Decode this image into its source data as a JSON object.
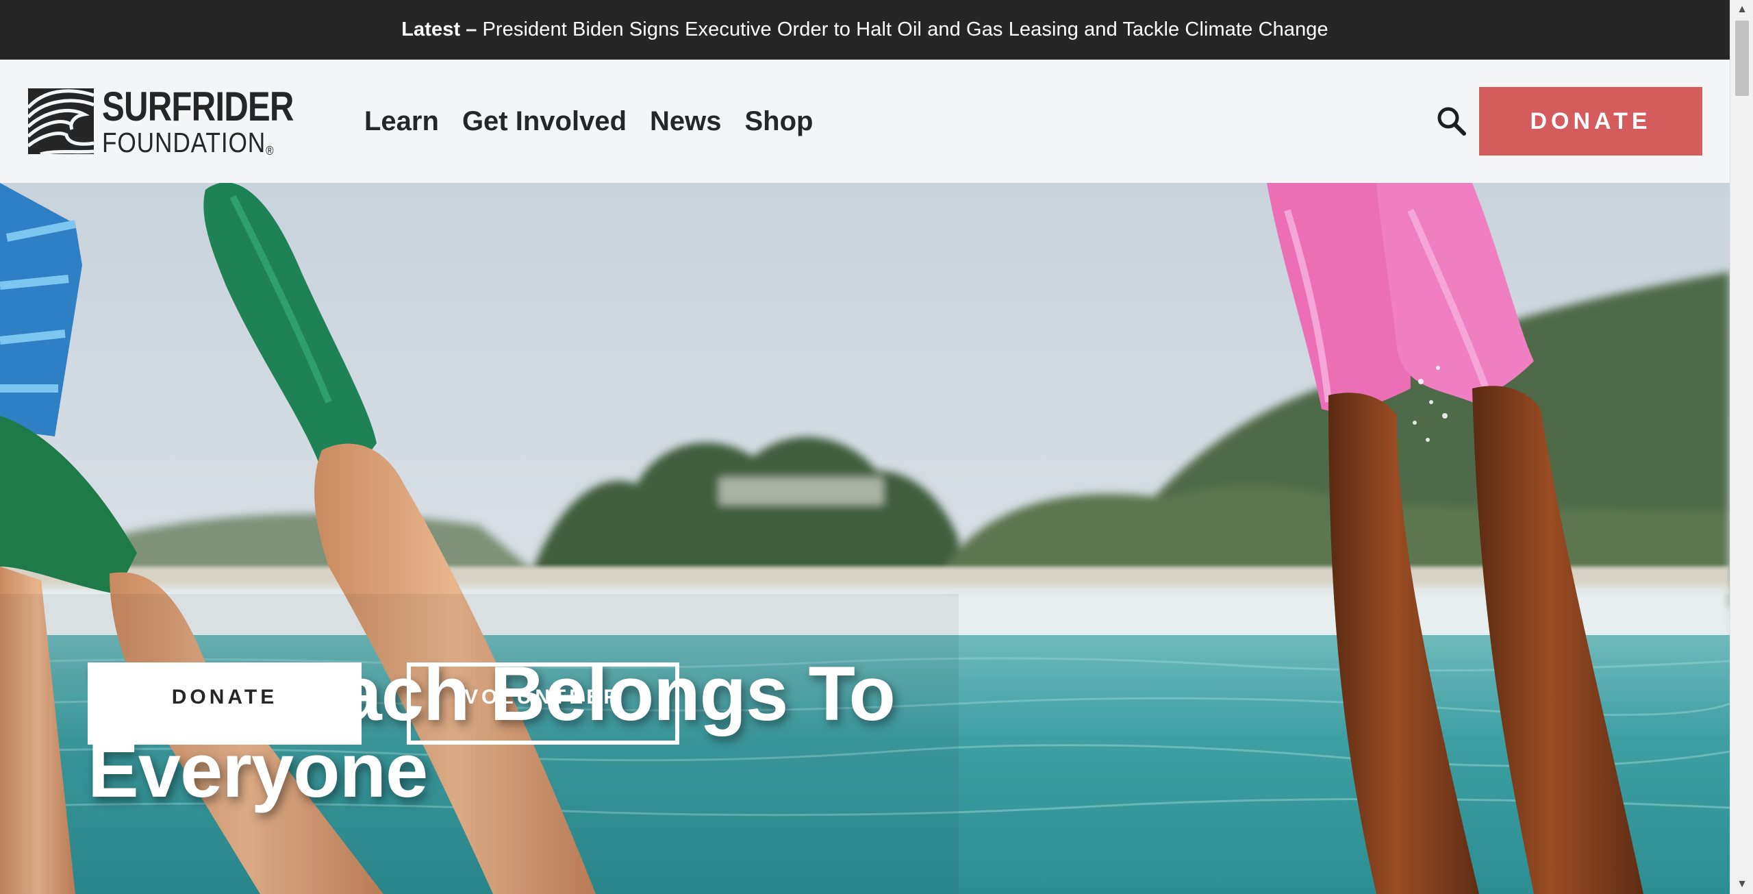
{
  "announcement": {
    "label": "Latest",
    "dash": "–",
    "headline": "President Biden Signs Executive Order to Halt Oil and Gas Leasing and Tackle Climate Change"
  },
  "header": {
    "logo": {
      "line1": "SURFRIDER",
      "line2": "FOUNDATION",
      "trademark": "®"
    },
    "nav": [
      {
        "label": "Learn"
      },
      {
        "label": "Get Involved"
      },
      {
        "label": "News"
      },
      {
        "label": "Shop"
      }
    ],
    "search_icon": "search-icon",
    "donate_label": "DONATE"
  },
  "hero": {
    "title": "The Beach Belongs To Everyone",
    "buttons": {
      "donate": "DONATE",
      "volunteer": "VOLUNTEER"
    },
    "image_description_icons": [
      "swim-fins",
      "ocean",
      "trees"
    ]
  },
  "colors": {
    "announce_bg": "#262627",
    "header_bg": "#f4f5f6",
    "donate_red": "#d45c5c",
    "text_dark": "#262627",
    "white": "#ffffff"
  },
  "scrollbar": {
    "up_icon": "▲",
    "down_icon": "▼"
  }
}
